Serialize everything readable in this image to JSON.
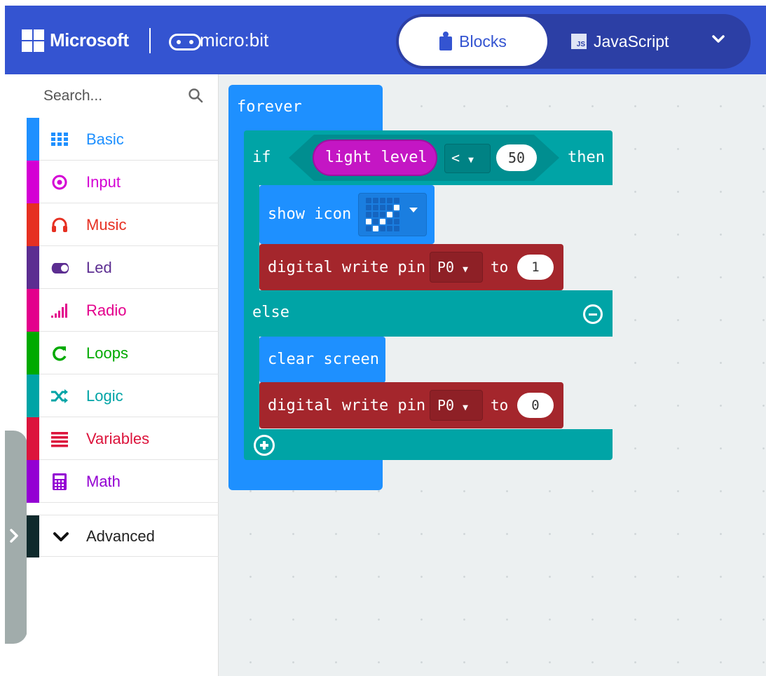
{
  "header": {
    "brand": "Microsoft",
    "product": "micro:bit",
    "tab_blocks": "Blocks",
    "tab_js": "JavaScript",
    "js_badge": "JS",
    "colors": {
      "header_bg": "#3454d1",
      "toggle_bg": "#2c3fa5"
    }
  },
  "search": {
    "placeholder": "Search..."
  },
  "categories": [
    {
      "label": "Basic",
      "color": "#1e90ff",
      "icon": "grid-icon"
    },
    {
      "label": "Input",
      "color": "#d400d4",
      "icon": "target-icon"
    },
    {
      "label": "Music",
      "color": "#e63022",
      "icon": "headphones-icon"
    },
    {
      "label": "Led",
      "color": "#5c2d91",
      "icon": "toggle-icon"
    },
    {
      "label": "Radio",
      "color": "#e3008c",
      "icon": "signal-bars-icon"
    },
    {
      "label": "Loops",
      "color": "#00aa00",
      "icon": "refresh-icon"
    },
    {
      "label": "Logic",
      "color": "#00a4a6",
      "icon": "shuffle-icon"
    },
    {
      "label": "Variables",
      "color": "#dc143c",
      "icon": "lines-icon"
    },
    {
      "label": "Math",
      "color": "#9400d3",
      "icon": "calculator-icon"
    }
  ],
  "advanced": {
    "label": "Advanced",
    "icon": "chevron-down-icon"
  },
  "blocks": {
    "forever": "forever",
    "if": "if",
    "light_level": "light level",
    "operator": "<",
    "threshold": "50",
    "then": "then",
    "show_icon": "show icon",
    "digital_write_1": {
      "label": "digital write pin",
      "pin": "P0",
      "to": "to",
      "value": "1"
    },
    "else": "else",
    "clear_screen": "clear screen",
    "digital_write_2": {
      "label": "digital write pin",
      "pin": "P0",
      "to": "to",
      "value": "0"
    }
  },
  "icon_pattern": [
    [
      0,
      0,
      0,
      0,
      0
    ],
    [
      0,
      0,
      0,
      0,
      1
    ],
    [
      0,
      0,
      0,
      1,
      0
    ],
    [
      1,
      0,
      1,
      0,
      0
    ],
    [
      0,
      1,
      0,
      0,
      0
    ]
  ]
}
